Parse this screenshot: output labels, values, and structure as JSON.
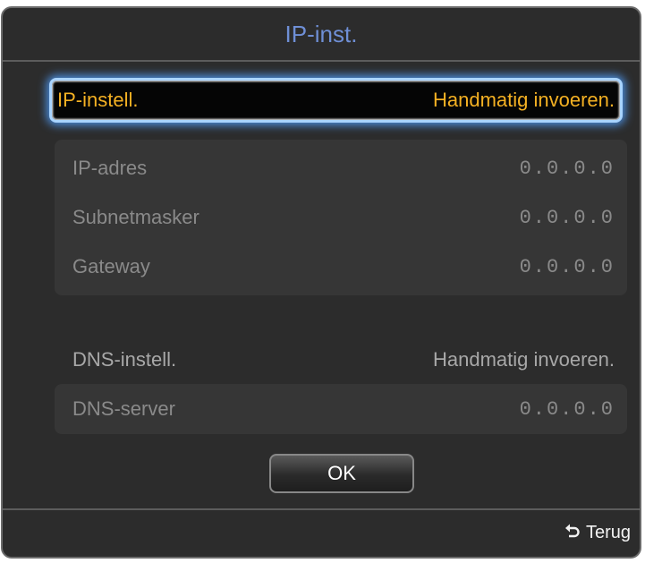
{
  "dialog": {
    "title": "IP-inst."
  },
  "ip_setting": {
    "label": "IP-instell.",
    "value": "Handmatig invoeren."
  },
  "ip_group": {
    "rows": [
      {
        "label": "IP-adres",
        "value": "0.0.0.0"
      },
      {
        "label": "Subnetmasker",
        "value": "0.0.0.0"
      },
      {
        "label": "Gateway",
        "value": "0.0.0.0"
      }
    ]
  },
  "dns_setting": {
    "label": "DNS-instell.",
    "value": "Handmatig invoeren."
  },
  "dns_group": {
    "rows": [
      {
        "label": "DNS-server",
        "value": "0.0.0.0"
      }
    ]
  },
  "ok_button": {
    "label": "OK"
  },
  "footer": {
    "back_icon": "return-arrow-icon",
    "back_label": "Terug"
  },
  "colors": {
    "title": "#6f8fd6",
    "focus_text": "#f5b123",
    "focus_glow": "#a9d4ff"
  }
}
